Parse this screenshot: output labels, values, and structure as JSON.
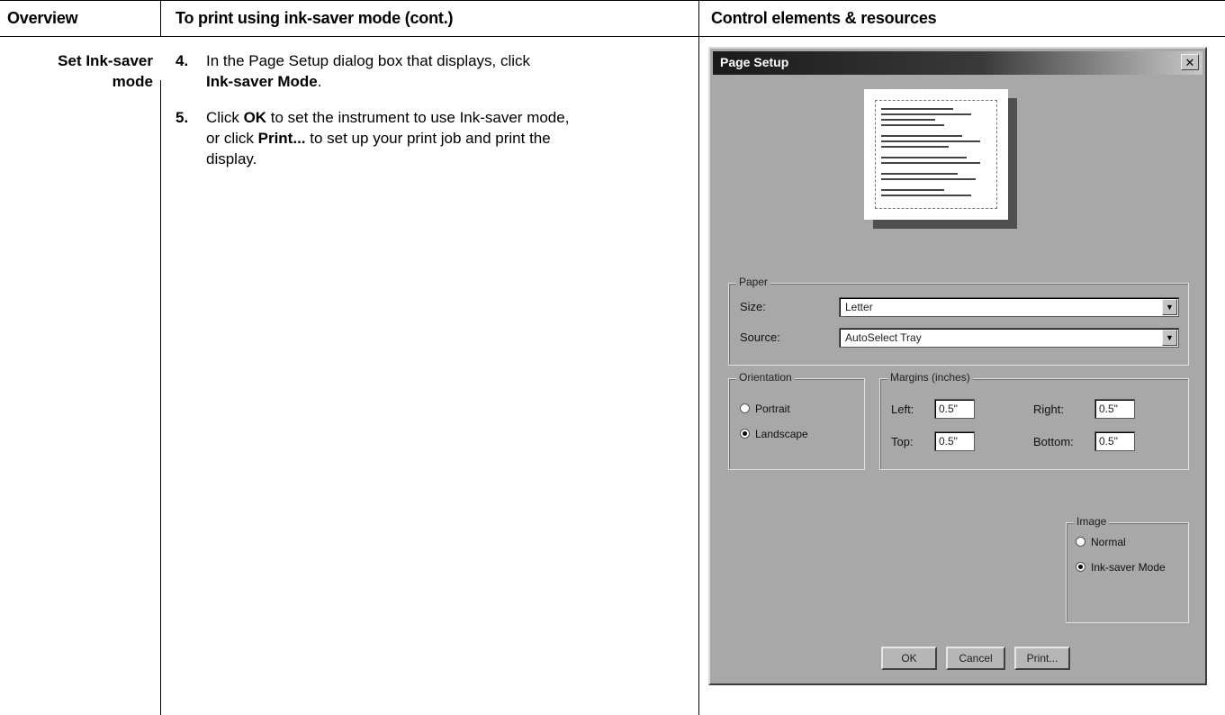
{
  "header": {
    "col1": "Overview",
    "col2": "To print using ink-saver mode (cont.)",
    "col3": "Control elements & resources"
  },
  "side_label": {
    "line1": "Set Ink-saver",
    "line2": "mode"
  },
  "steps": [
    {
      "num": "4.",
      "t1": "In the Page Setup dialog box that displays, click",
      "b1": "Ink-saver Mode",
      "t2": "."
    },
    {
      "num": "5.",
      "t1": "Click ",
      "b1": "OK",
      "t2": " to set the instrument to use Ink-saver mode,",
      "t3": "or click ",
      "b2": "Print...",
      "t4": " to set up your print job and print the",
      "t5": "display."
    }
  ],
  "dialog": {
    "title": "Page Setup",
    "close_glyph": "✕",
    "paper": {
      "legend": "Paper",
      "size_label": "Size:",
      "size_value": "Letter",
      "source_label": "Source:",
      "source_value": "AutoSelect Tray",
      "arrow_glyph": "▼"
    },
    "orientation": {
      "legend": "Orientation",
      "portrait": "Portrait",
      "landscape": "Landscape",
      "selected": "landscape"
    },
    "margins": {
      "legend": "Margins (inches)",
      "left_label": "Left:",
      "left_value": "0.5\"",
      "right_label": "Right:",
      "right_value": "0.5\"",
      "top_label": "Top:",
      "top_value": "0.5\"",
      "bottom_label": "Bottom:",
      "bottom_value": "0.5\""
    },
    "image": {
      "legend": "Image",
      "normal": "Normal",
      "ink_saver": "Ink-saver Mode",
      "selected": "ink_saver"
    },
    "buttons": {
      "ok": "OK",
      "cancel": "Cancel",
      "print": "Print..."
    }
  }
}
